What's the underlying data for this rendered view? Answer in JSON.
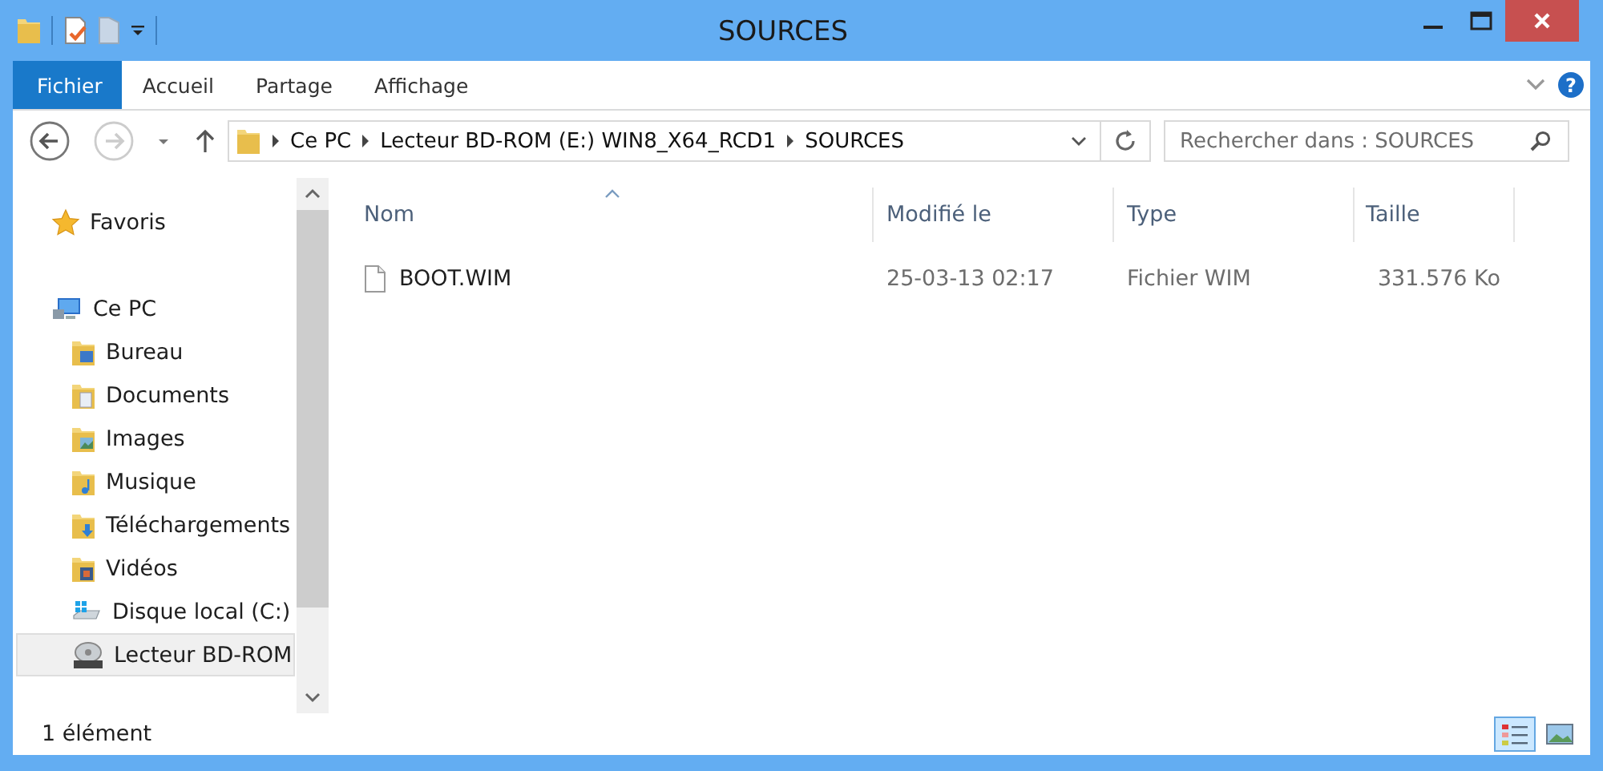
{
  "window": {
    "title": "SOURCES"
  },
  "ribbon": {
    "help": "?",
    "tabs": [
      {
        "label": "Fichier",
        "selected": true
      },
      {
        "label": "Accueil",
        "selected": false
      },
      {
        "label": "Partage",
        "selected": false
      },
      {
        "label": "Affichage",
        "selected": false
      }
    ]
  },
  "address": {
    "path": [
      "Ce PC",
      "Lecteur BD-ROM (E:) WIN8_X64_RCD1",
      "SOURCES"
    ]
  },
  "search": {
    "placeholder": "Rechercher dans : SOURCES"
  },
  "sidebar": {
    "items": [
      {
        "label": "Favoris",
        "selected": false
      },
      {
        "label": "Ce PC",
        "selected": false,
        "children": [
          {
            "label": "Bureau",
            "selected": false
          },
          {
            "label": "Documents",
            "selected": false
          },
          {
            "label": "Images",
            "selected": false
          },
          {
            "label": "Musique",
            "selected": false
          },
          {
            "label": "Téléchargements",
            "selected": false
          },
          {
            "label": "Vidéos",
            "selected": false
          },
          {
            "label": "Disque local (C:)",
            "selected": false
          },
          {
            "label": "Lecteur BD-ROM",
            "selected": true
          }
        ]
      }
    ]
  },
  "table": {
    "columns": [
      {
        "label": "Nom",
        "sorted": true
      },
      {
        "label": "Modifié le",
        "sorted": false
      },
      {
        "label": "Type",
        "sorted": false
      },
      {
        "label": "Taille",
        "sorted": false
      }
    ],
    "rows": [
      {
        "cells": [
          "BOOT.WIM",
          "25-03-13 02:17",
          "Fichier WIM",
          "331.576 Ko"
        ],
        "selected": false
      }
    ]
  },
  "status_bar": {
    "text": "1 élément",
    "views": [
      {
        "selected": true
      },
      {
        "selected": false
      }
    ]
  }
}
